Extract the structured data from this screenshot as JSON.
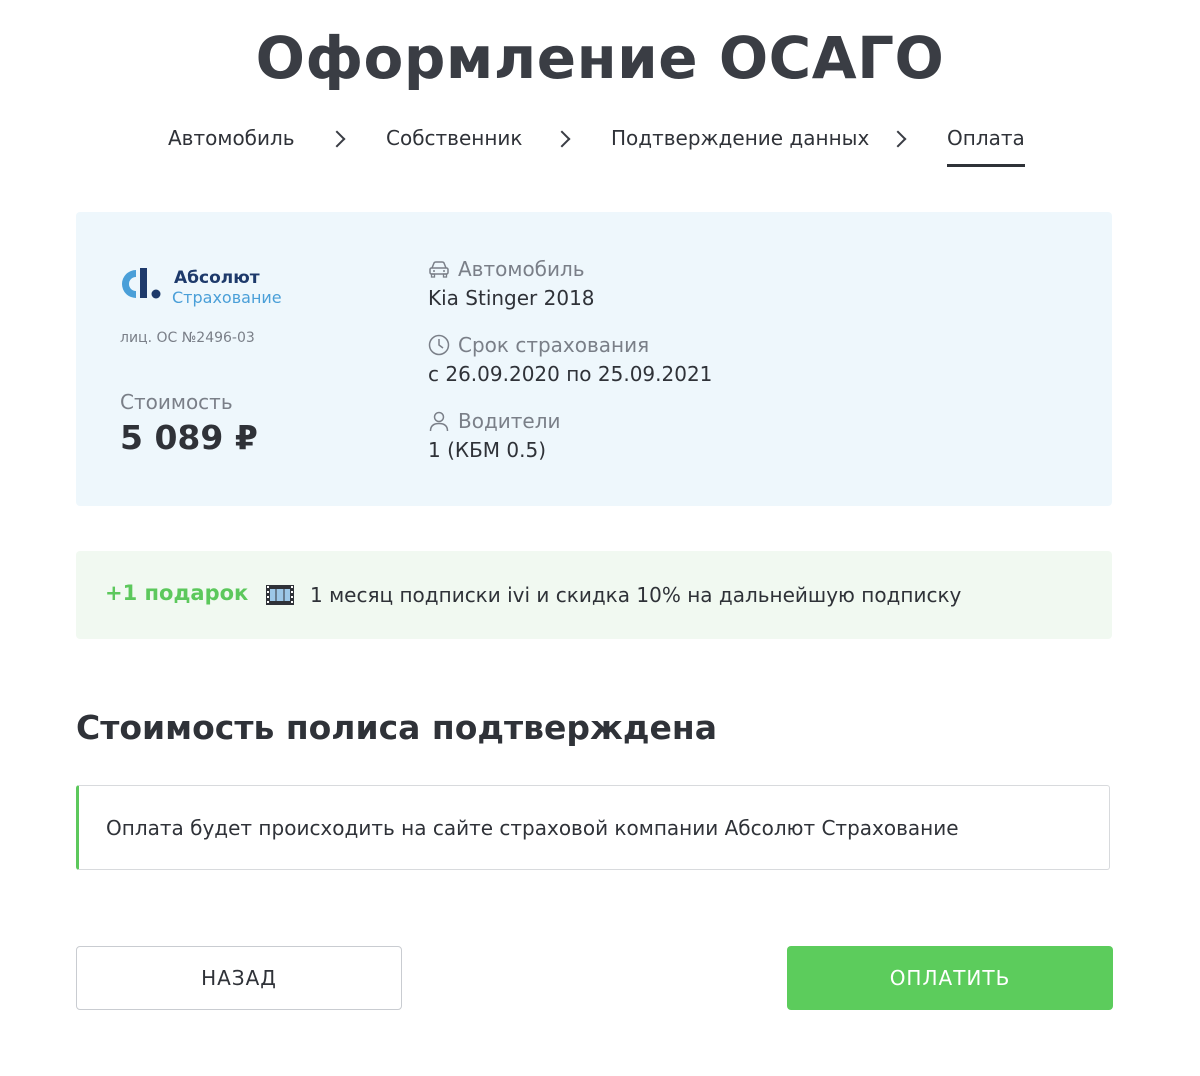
{
  "page": {
    "title": "Оформление ОСАГО"
  },
  "steps": [
    {
      "label": "Автомобиль",
      "active": false
    },
    {
      "label": "Собственник",
      "active": false
    },
    {
      "label": "Подтверждение данных",
      "active": false
    },
    {
      "label": "Оплата",
      "active": true
    }
  ],
  "offer": {
    "insurer_name_line1": "Абсолют",
    "insurer_name_line2": "Страхование",
    "license": "лиц. ОС №2496-03",
    "cost_label": "Стоимость",
    "cost_value": "5 089 ₽",
    "car_label": "Автомобиль",
    "car_value": "Kia Stinger 2018",
    "term_label": "Срок страхования",
    "term_value": "с 26.09.2020 по 25.09.2021",
    "drivers_label": "Водители",
    "drivers_value": "1 (КБМ 0.5)",
    "brand_color": "#1e3a6b",
    "brand_accent": "#4a9fd8"
  },
  "gift": {
    "label": "+1 подарок",
    "icon": "film-icon",
    "text": "1 месяц подписки ivi и скидка 10% на дальнейшую подписку"
  },
  "confirmation": {
    "title": "Стоимость полиса подтверждена",
    "notice": "Оплата будет происходить на сайте страховой компании Абсолют Страхование"
  },
  "actions": {
    "back_label": "НАЗАД",
    "pay_label": "ОПЛАТИТЬ"
  },
  "colors": {
    "accent_green": "#5ccc5c",
    "card_bg": "#eef7fc",
    "gift_bg": "#f1f9f1"
  }
}
